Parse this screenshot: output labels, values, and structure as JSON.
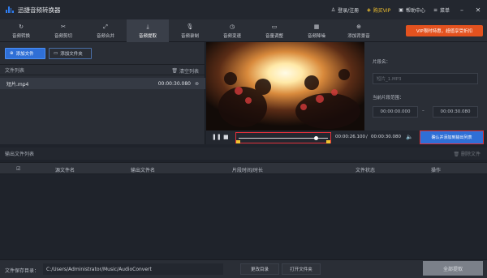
{
  "app": {
    "title": "迅捷音频转换器"
  },
  "titlebar": {
    "login": "登录/注册",
    "buy_vip": "购买VIP",
    "help": "帮助中心",
    "menu": "菜单"
  },
  "tools": [
    {
      "label": "音频转换",
      "icon": "↻"
    },
    {
      "label": "音频剪切",
      "icon": "✂"
    },
    {
      "label": "音频合并",
      "icon": "⤢"
    },
    {
      "label": "音频提取",
      "icon": "⤓"
    },
    {
      "label": "音频录制",
      "icon": "🎙"
    },
    {
      "label": "音频变速",
      "icon": "◷"
    },
    {
      "label": "音量调整",
      "icon": "▭"
    },
    {
      "label": "音频降噪",
      "icon": "▦"
    },
    {
      "label": "添加背景音",
      "icon": "⊕"
    }
  ],
  "vip_banner": "VIP限时特惠，超值享受折扣",
  "left": {
    "add_file": "添加文件",
    "add_folder": "添加文件夹",
    "list_title": "文件列表",
    "clear_list": "清空列表",
    "files": [
      {
        "name": "短片.mp4",
        "duration": "00:00:30.080"
      }
    ]
  },
  "right": {
    "clip_name_label": "片段名：",
    "clip_name_placeholder": "短片_1.MP3",
    "range_label": "当前片段范围：",
    "start_time": "00:00:00.000",
    "end_time": "00:00:30.080"
  },
  "player": {
    "current_time": "00:00:26.100",
    "separator": "/",
    "total_time": "00:00:30.080",
    "confirm": "确认并添加到输出列表"
  },
  "output": {
    "title": "输出文件列表",
    "delete_files": "删除文件",
    "columns": [
      "源文件名",
      "输出文件名",
      "片段时间/时长",
      "文件状态",
      "操作"
    ]
  },
  "footer": {
    "save_label": "文件保存目录：",
    "save_path": "C:/Users/Administrator/Music/AudioConvert",
    "change_dir": "更改目录",
    "open_folder": "打开文件夹",
    "convert_all": "全部提取"
  }
}
